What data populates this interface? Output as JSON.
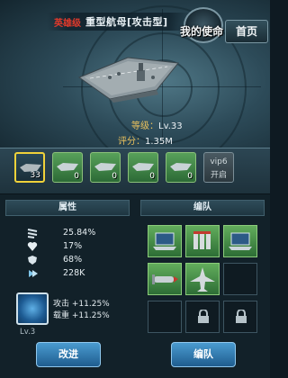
{
  "header": {
    "rarity_tag": "英雄级",
    "ship_name": "重型航母[攻击型]",
    "logo_text": "我的使命",
    "close_label": "首页"
  },
  "ship_info": {
    "level_label": "等级：",
    "level_value": "Lv.33",
    "score_label": "评分：",
    "score_value": "1.35M"
  },
  "slots": [
    {
      "count": "33",
      "selected": true
    },
    {
      "count": "0"
    },
    {
      "count": "0"
    },
    {
      "count": "0"
    },
    {
      "count": "0"
    },
    {
      "count": "0"
    }
  ],
  "vip_slot": {
    "line1": "vip6",
    "line2": "开启"
  },
  "attributes": {
    "title": "属性",
    "stats": [
      {
        "icon": "torpedo-icon",
        "value": "25.84%"
      },
      {
        "icon": "heart-icon",
        "value": "17%"
      },
      {
        "icon": "shield-icon",
        "value": "68%"
      },
      {
        "icon": "speed-icon",
        "value": "228K"
      }
    ],
    "skill": {
      "icon": "skill-icon",
      "line1": "攻击 +11.25%",
      "line2": "载重 +11.25%",
      "level": "Lv.3"
    },
    "button_label": "改进"
  },
  "fleet": {
    "title": "编队",
    "items": [
      "laptop-icon",
      "missile-rack-icon",
      "laptop-icon",
      "torpedo-icon",
      "jet-icon",
      "empty",
      "empty",
      "lock-icon",
      "lock-icon"
    ],
    "button_label": "编队"
  },
  "colors": {
    "accent_gold": "#e9c15d",
    "rarity_red": "#e03a2c",
    "slot_green": "#58a15a",
    "button_blue": "#3a8cc4"
  }
}
